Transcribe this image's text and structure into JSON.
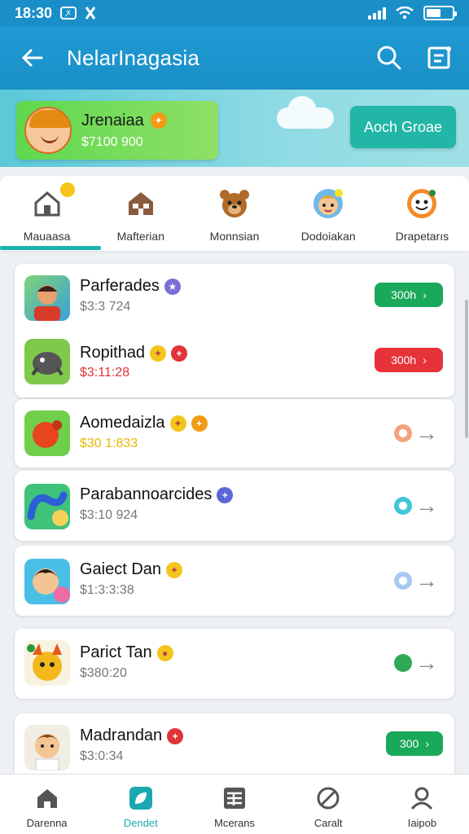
{
  "status_bar": {
    "time": "18:30",
    "badge": "ꭗ",
    "battery_level": 0.55
  },
  "app_bar": {
    "title": "NelarInagasia"
  },
  "profile": {
    "name": "Jrenaiaa",
    "amount": "$7100 900"
  },
  "banner_button": "Aoch Groae",
  "categories": [
    {
      "label": "Mauaasa"
    },
    {
      "label": "Mafterian"
    },
    {
      "label": "Monnsian"
    },
    {
      "label": "Dodoiakan"
    },
    {
      "label": "Drapetarıs"
    }
  ],
  "list": [
    {
      "name": "Parferades",
      "sub": "$3:3 724",
      "sub_color": "#777777",
      "action": "300h",
      "action_color": "#1aa85a"
    },
    {
      "name": "Ropithad",
      "sub": "$3:11:28",
      "sub_color": "#e0333a",
      "action": "300h",
      "action_color": "#e6333a"
    },
    {
      "name": "Aomedaizla",
      "sub": "$30 1:833",
      "sub_color": "#e6b800"
    },
    {
      "name": "Parabannoarcides",
      "sub": "$3:10 924",
      "sub_color": "#777777"
    },
    {
      "name": "Gaiect Dan",
      "sub": "$1:3:3:38",
      "sub_color": "#777777"
    },
    {
      "name": "Parict Tan",
      "sub": "$380:20",
      "sub_color": "#777777"
    },
    {
      "name": "Madrandan",
      "sub": "$3:0:34",
      "sub_color": "#777777",
      "action": "300",
      "action_color": "#1aa85a"
    }
  ],
  "bottom_nav": [
    {
      "label": "Darenna"
    },
    {
      "label": "Dendet"
    },
    {
      "label": "Mcerans"
    },
    {
      "label": "Caralt"
    },
    {
      "label": "Iaipob"
    }
  ]
}
